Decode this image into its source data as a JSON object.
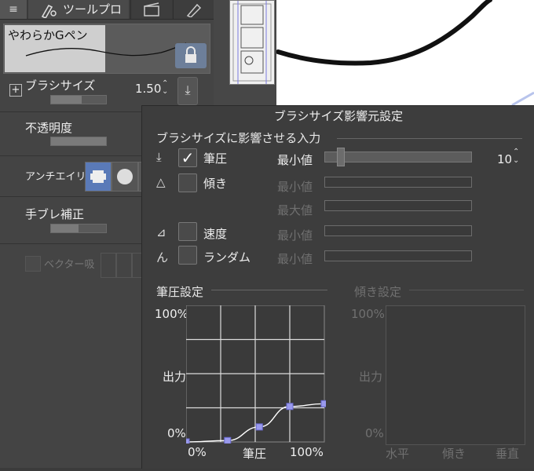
{
  "tool_panel": {
    "menu_icon": "hamburger-icon",
    "tab_tool_label": "ツールプロ",
    "brush_preview_name": "やわらかGペン",
    "brush_size_label": "ブラシサイズ",
    "brush_size_value": "1.50",
    "opacity_label": "不透明度",
    "antialias_label": "アンチエイリ",
    "stabilization_label": "手ブレ補正",
    "vector_label": "ベクター吸",
    "brush_size_fill": 0.55,
    "opacity_fill": 1.0,
    "stabilization_fill": 0.5
  },
  "dialog": {
    "title": "ブラシサイズ影響元設定",
    "input_section": "ブラシサイズに影響させる入力",
    "inputs": [
      {
        "label": "筆圧",
        "checked": true,
        "icon": "pen-pressure-icon"
      },
      {
        "label": "傾き",
        "checked": false,
        "icon": "tilt-icon"
      },
      {
        "label": "速度",
        "checked": false,
        "icon": "speed-icon"
      },
      {
        "label": "ランダム",
        "checked": false,
        "icon": "random-icon"
      }
    ],
    "slider_labels": {
      "min": "最小値",
      "max": "最大値"
    },
    "min_value": "10",
    "min_fraction": 0.1,
    "pressure_section": "筆圧設定",
    "tilt_section": "傾き設定",
    "graph": {
      "y_top": "100%",
      "y_mid": "出力",
      "y_bottom": "0%",
      "x_left": "0%",
      "x_mid": "筆圧",
      "x_right": "100%"
    },
    "tilt_graph": {
      "y_top": "100%",
      "y_mid": "出力",
      "y_bottom": "0%",
      "x_left": "水平",
      "x_mid": "傾き",
      "x_right": "垂直"
    },
    "curve_points": [
      [
        0,
        0
      ],
      [
        0.3,
        0.01
      ],
      [
        0.53,
        0.11
      ],
      [
        0.75,
        0.26
      ],
      [
        1.0,
        0.28
      ]
    ],
    "accent": "#9a9aee"
  }
}
